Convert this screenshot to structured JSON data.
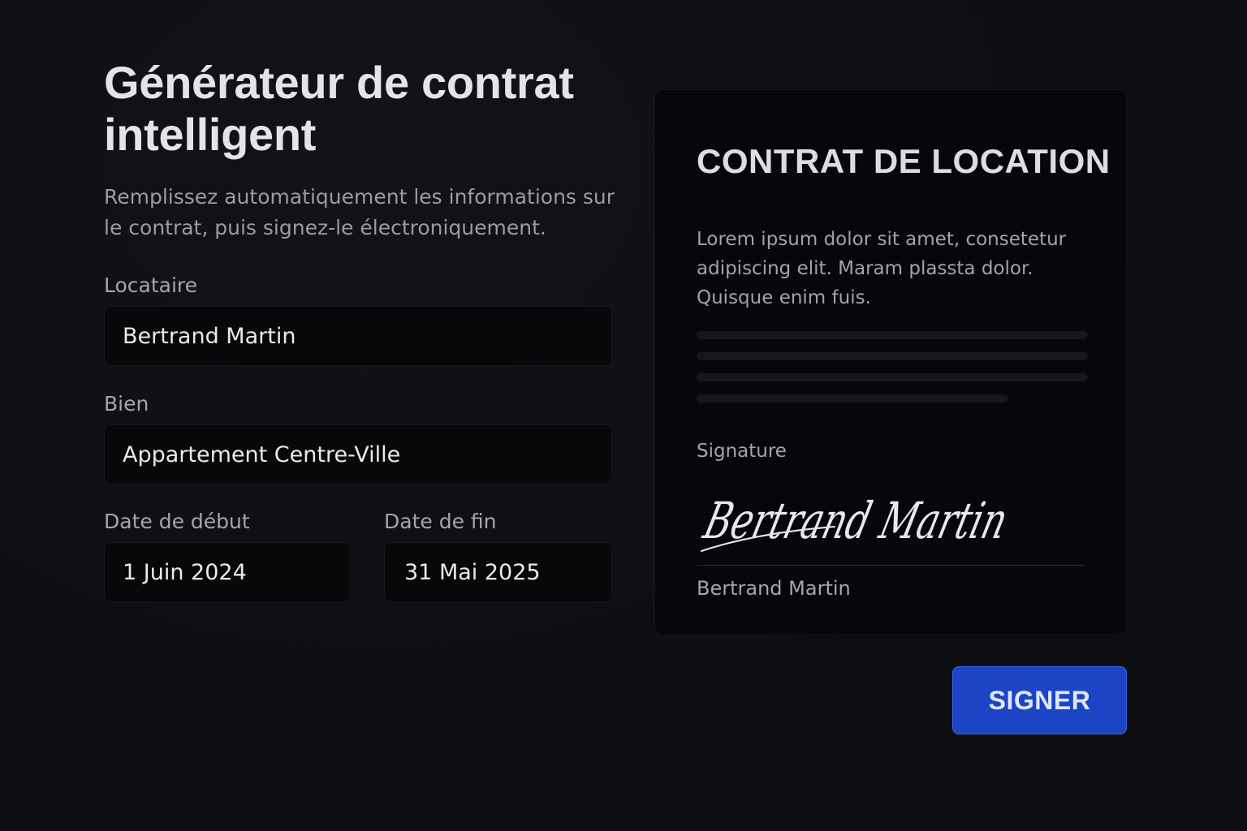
{
  "form": {
    "title": "Générateur de contrat intelligent",
    "subtitle": "Remplissez automatiquement les informations sur le contrat, puis signez-le électroniquement.",
    "tenant": {
      "label": "Locataire",
      "value": "Bertrand Martin"
    },
    "property": {
      "label": "Bien",
      "value": "Appartement Centre-Ville"
    },
    "start_date": {
      "label": "Date de début",
      "value": "1 Juin 2024"
    },
    "end_date": {
      "label": "Date de fin",
      "value": "31 Mai 2025"
    }
  },
  "contract": {
    "title": "CONTRAT DE LOCATION",
    "body": "Lorem ipsum dolor sit amet, consetetur adipiscing elit. Maram plassta dolor. Quisque enim fuis.",
    "signature_label": "Signature",
    "signature_script": "Bertrand Martin",
    "signer_name": "Bertrand Martin"
  },
  "actions": {
    "sign_label": "SIGNER"
  },
  "colors": {
    "background": "#0e0f12",
    "card": "#06070a",
    "input": "#07080a",
    "accent": "#1b45c4"
  }
}
